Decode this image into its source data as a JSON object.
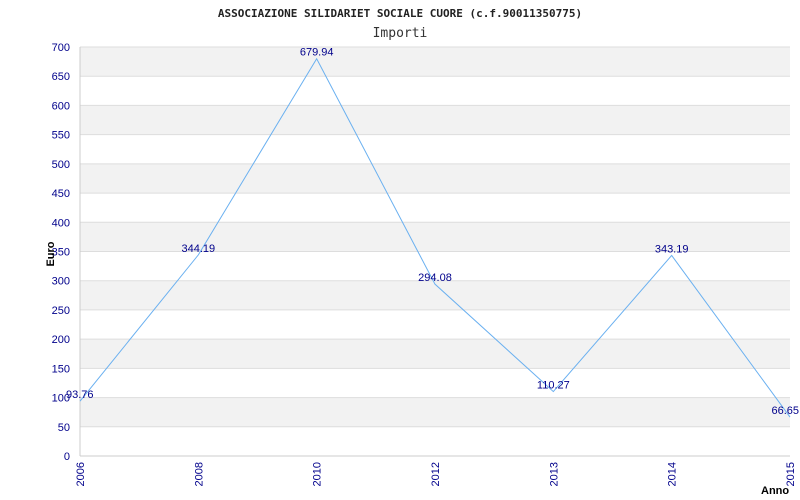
{
  "chart_data": {
    "type": "line",
    "title": "ASSOCIAZIONE SILIDARIET SOCIALE CUORE (c.f.90011350775)",
    "subtitle": "Importi",
    "xlabel": "Anno",
    "ylabel": "Euro",
    "categories": [
      "2006",
      "2008",
      "2010",
      "2012",
      "2013",
      "2014",
      "2015"
    ],
    "values": [
      93.76,
      344.19,
      679.94,
      294.08,
      110.27,
      343.19,
      66.65
    ],
    "value_labels": [
      "93.76",
      "344.19",
      "679.94",
      "294.08",
      "110.27",
      "343.19",
      "66.65"
    ],
    "ylim": [
      0,
      700
    ],
    "yticks": [
      0,
      50,
      100,
      150,
      200,
      250,
      300,
      350,
      400,
      450,
      500,
      550,
      600,
      650,
      700
    ],
    "grid": true,
    "colors": {
      "line": "#6ab0f0",
      "band": "#f2f2f2",
      "grid": "#dddddd",
      "text": "#00008b"
    }
  }
}
